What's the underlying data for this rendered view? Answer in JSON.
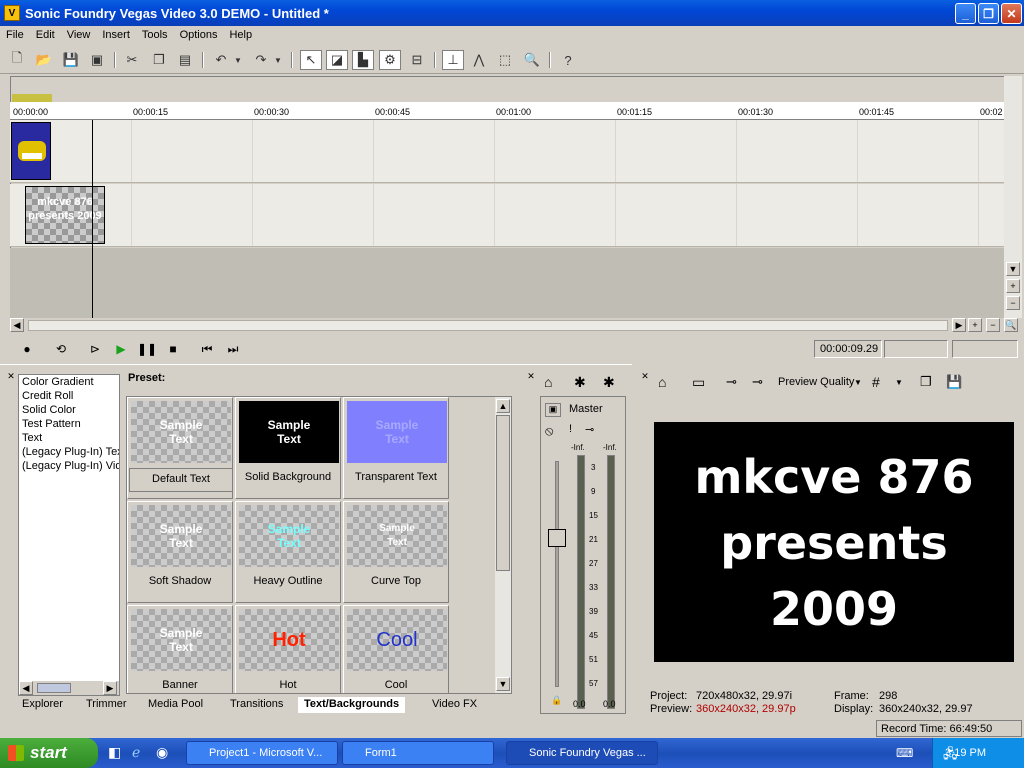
{
  "window": {
    "title": "Sonic Foundry Vegas Video 3.0 DEMO - Untitled *"
  },
  "menu": [
    "File",
    "Edit",
    "View",
    "Insert",
    "Tools",
    "Options",
    "Help"
  ],
  "ruler": {
    "ticks": [
      "00:00:00",
      "00:00:15",
      "00:00:30",
      "00:00:45",
      "00:01:00",
      "00:01:15",
      "00:01:30",
      "00:01:45",
      "00:02"
    ]
  },
  "clip_text": "mkcve 876 presents 2009",
  "transport": {
    "time": "00:00:09.29"
  },
  "tree": {
    "items": [
      "Color Gradient",
      "Credit Roll",
      "Solid Color",
      "Test Pattern",
      "Text",
      "(Legacy Plug-In) Text",
      "(Legacy Plug-In) Video"
    ]
  },
  "preset": {
    "label": "Preset:",
    "items": [
      {
        "name": "Default Text",
        "thumb": "Sample Text"
      },
      {
        "name": "Solid Background",
        "thumb": "Sample Text"
      },
      {
        "name": "Transparent Text",
        "thumb": "Sample Text"
      },
      {
        "name": "Soft Shadow",
        "thumb": "Sample Text"
      },
      {
        "name": "Heavy Outline",
        "thumb": "Sample Text"
      },
      {
        "name": "Curve Top",
        "thumb": "Sample Text"
      },
      {
        "name": "Banner",
        "thumb": "Sample Text"
      },
      {
        "name": "Hot",
        "thumb": "Hot"
      },
      {
        "name": "Cool",
        "thumb": "Cool"
      }
    ]
  },
  "tabs": [
    "Explorer",
    "Trimmer",
    "Media Pool",
    "Transitions",
    "Text/Backgrounds",
    "Video FX"
  ],
  "mixer": {
    "label": "Master",
    "scale": [
      "-Inf.",
      "3",
      "9",
      "15",
      "21",
      "27",
      "33",
      "39",
      "45",
      "51",
      "57"
    ],
    "left_value": "0.0",
    "right_value": "0.0"
  },
  "preview": {
    "quality_label": "Preview Quality",
    "text_lines": [
      "mkcve 876",
      "presents",
      "2009"
    ],
    "project_label": "Project:",
    "project_value": "720x480x32, 29.97i",
    "preview_label": "Preview:",
    "preview_value": "360x240x32, 29.97p",
    "frame_label": "Frame:",
    "frame_value": "298",
    "display_label": "Display:",
    "display_value": "360x240x32, 29.97",
    "record_time": "Record Time: 66:49:50"
  },
  "taskbar": {
    "start": "start",
    "tasks": [
      "Project1 - Microsoft V...",
      "Form1",
      "Sonic Foundry Vegas ..."
    ],
    "clock": "3:19 PM"
  },
  "colors": {
    "titlebar": "#0a5fe0",
    "preview_bg": "#000000",
    "hot": "#ff2200",
    "cool": "#2233cc"
  }
}
